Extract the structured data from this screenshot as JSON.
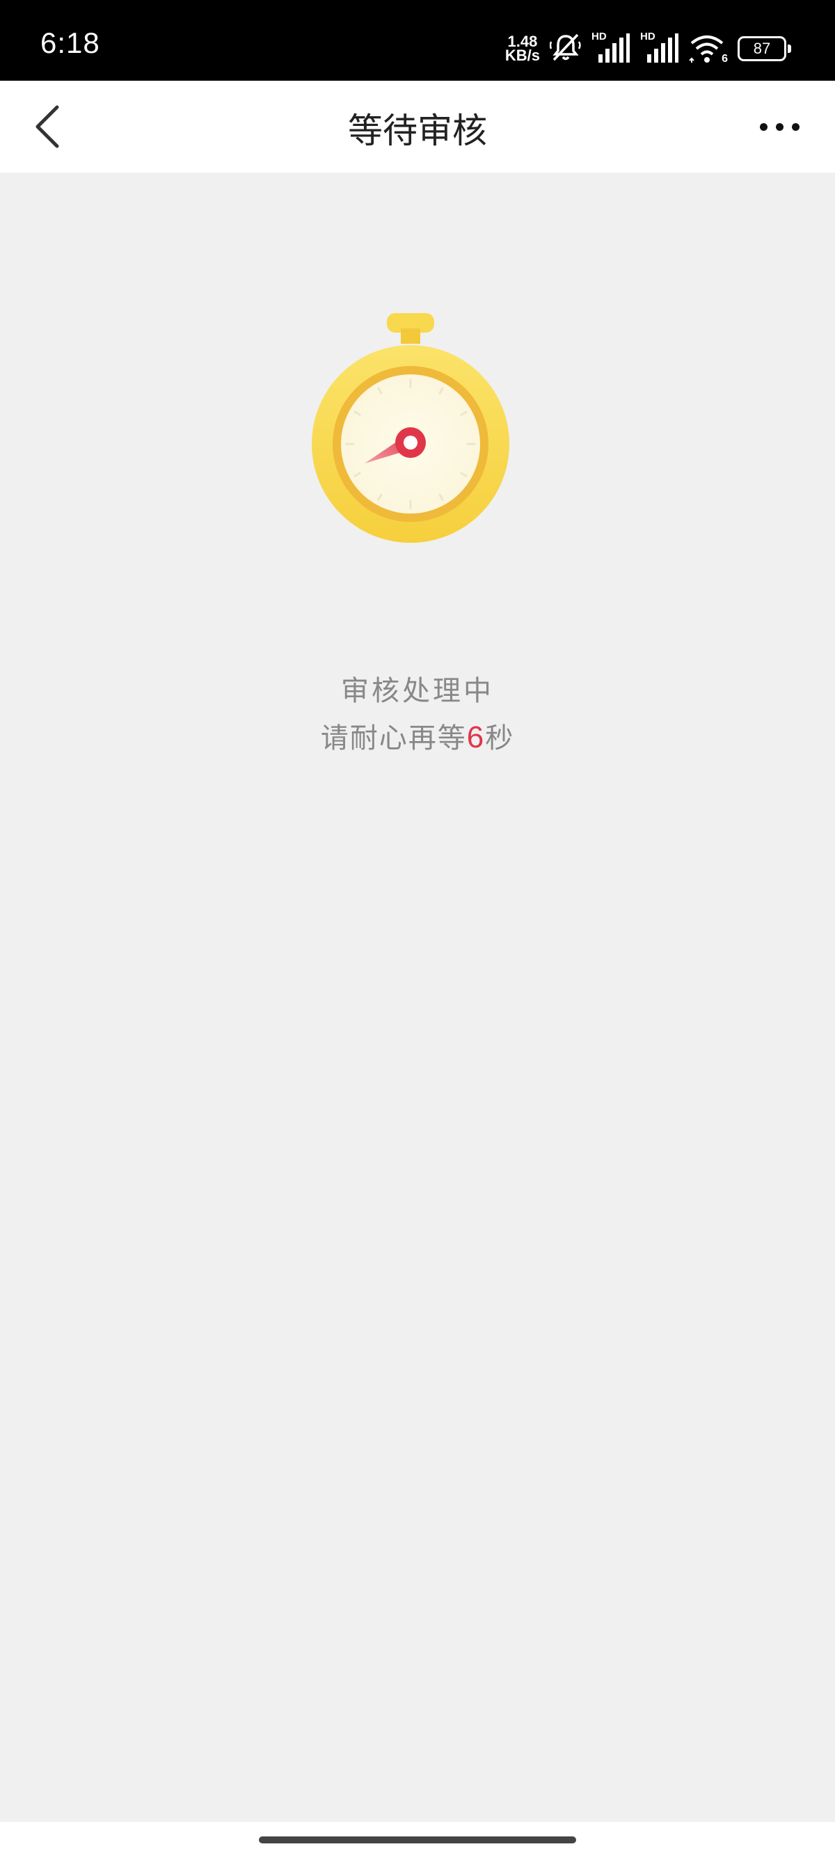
{
  "status_bar": {
    "time": "6:18",
    "net_speed_value": "1.48",
    "net_speed_unit": "KB/s",
    "signal1_label": "HD",
    "signal2_label": "HD",
    "wifi_label": "6",
    "battery_level": "87"
  },
  "nav": {
    "title": "等待审核"
  },
  "icons": {
    "back": "chevron-left-icon",
    "more": "more-dots-icon",
    "stopwatch": "stopwatch-icon"
  },
  "message": {
    "line1": "审核处理中",
    "line2_prefix": "请耐心再等",
    "countdown": "6",
    "line2_suffix": "秒"
  },
  "colors": {
    "accent_red": "#e0364a",
    "stopwatch_yellow": "#f8d44a",
    "page_bg": "#f0f0f0"
  }
}
